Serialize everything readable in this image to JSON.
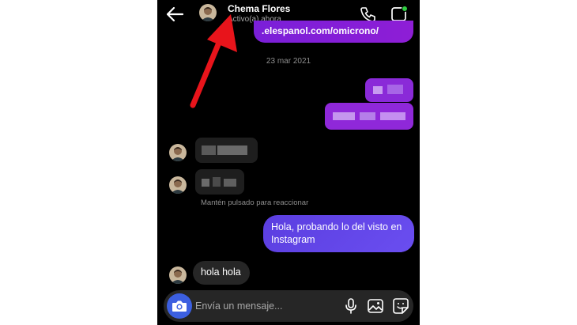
{
  "header": {
    "name": "Chema Flores",
    "status": "Activo(a) ahora"
  },
  "messages": {
    "link_text": ".elespanol.com/omicrono/",
    "date_separator": "23 mar 2021",
    "react_hint": "Mantén pulsado para reaccionar",
    "sent_text": "Hola, probando lo del visto en Instagram",
    "received_text": "hola hola"
  },
  "composer": {
    "placeholder": "Envía un mensaje..."
  },
  "colors": {
    "background": "#000000",
    "sent_bubble": "#5b3ee0",
    "link_bubble": "#8a1ed8",
    "received_bubble": "#262626",
    "camera_button": "#3c5fe0",
    "online_dot": "#2ecc40",
    "annotation_arrow": "#e8141b"
  },
  "icons": {
    "back": "arrow-left-icon",
    "call": "phone-icon",
    "video": "video-camera-icon",
    "camera": "camera-icon",
    "mic": "microphone-icon",
    "gallery": "image-icon",
    "sticker": "sticker-icon"
  }
}
